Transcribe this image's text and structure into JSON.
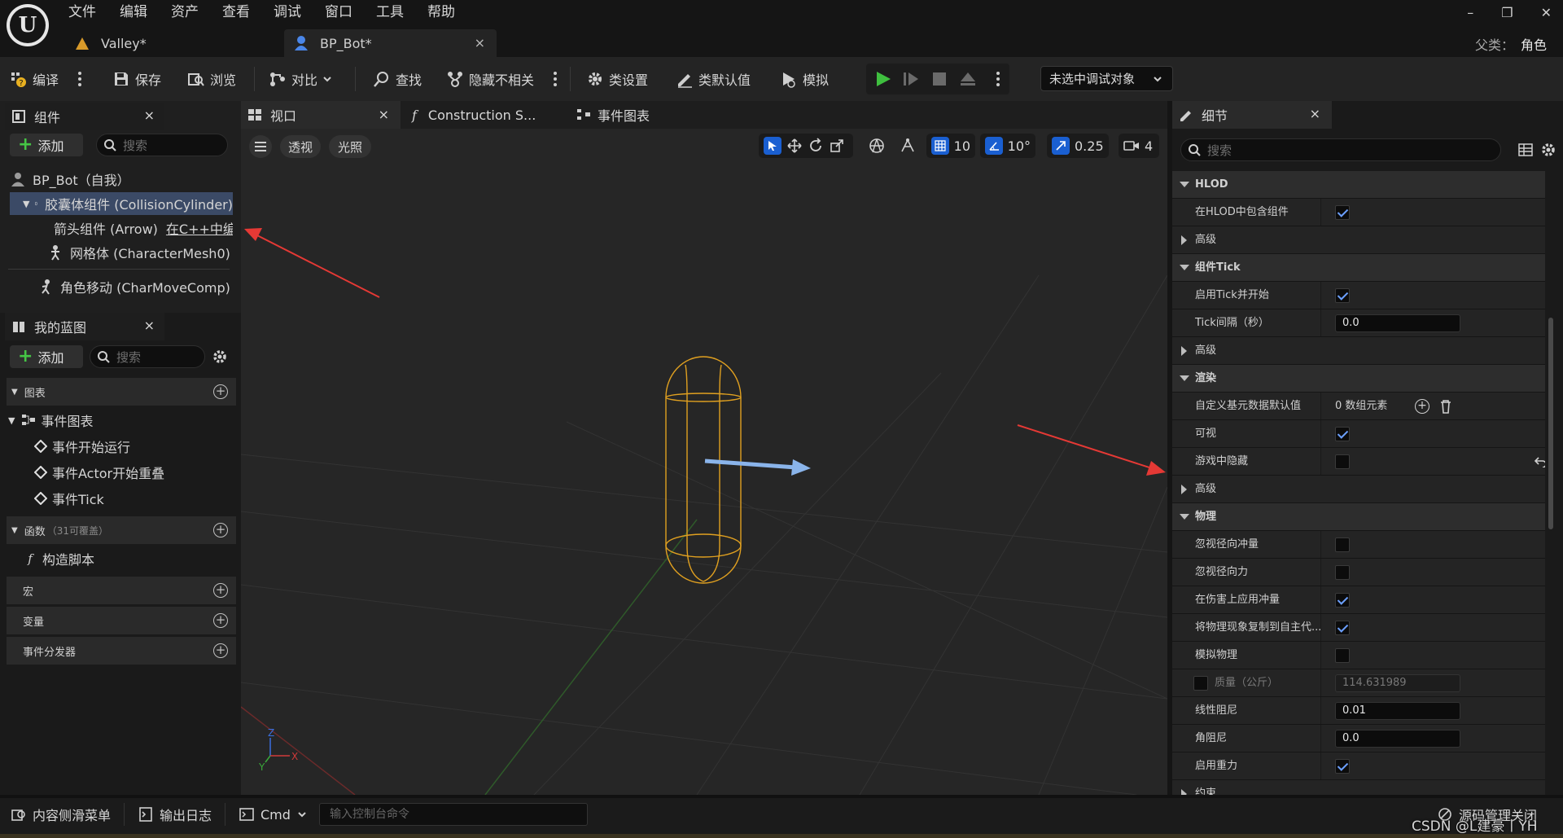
{
  "app": {
    "logo_text": "U"
  },
  "menu": [
    "文件",
    "编辑",
    "资产",
    "查看",
    "调试",
    "窗口",
    "工具",
    "帮助"
  ],
  "tabs": [
    {
      "label": "Valley*",
      "active": false
    },
    {
      "label": "BP_Bot*",
      "active": true,
      "close": "×"
    }
  ],
  "window_controls": {
    "minimize": "–",
    "restore": "❐",
    "close": "✕"
  },
  "parent_class": {
    "label": "父类：",
    "value": "角色"
  },
  "toolbar": {
    "compile": "编译",
    "save": "保存",
    "browse": "浏览",
    "diff": "对比",
    "find": "查找",
    "hide_unrelated": "隐藏不相关",
    "class_settings": "类设置",
    "class_defaults": "类默认值",
    "simulate": "模拟",
    "debug_object": "未选中调试对象",
    "play_color": "#3fbf3f"
  },
  "components_panel": {
    "title": "组件",
    "close": "×",
    "add": "添加",
    "search_placeholder": "搜索",
    "tree": [
      {
        "label": "BP_Bot（自我）"
      },
      {
        "label": "胶囊体组件 (CollisionCylinder)",
        "selected": true
      },
      {
        "label": "箭头组件 (Arrow)",
        "suffix": "在C++中编辑"
      },
      {
        "label": "网格体 (CharacterMesh0)"
      },
      {
        "label": "角色移动 (CharMoveComp)"
      }
    ]
  },
  "my_blueprint": {
    "title": "我的蓝图",
    "close": "×",
    "add": "添加",
    "search_placeholder": "搜索",
    "sections": {
      "graphs": "图表",
      "event_graph": "事件图表",
      "events": [
        "事件开始运行",
        "事件Actor开始重叠",
        "事件Tick"
      ],
      "functions": "函数",
      "functions_note": "（31可覆盖）",
      "construction_script": "构造脚本",
      "macros": "宏",
      "variables": "变量",
      "dispatchers": "事件分发器"
    }
  },
  "viewport": {
    "tabs": [
      "视口",
      "Construction S...",
      "事件图表"
    ],
    "close": "×",
    "perspective": "透视",
    "lighting": "光照",
    "grid_snap": "10",
    "rotation_snap": "10°",
    "scale_snap": "0.25",
    "camera_speed": "4",
    "capsule_color": "#e0a020",
    "arrow_color": "#8ab4ea",
    "axis": {
      "x": "X",
      "y": "Y",
      "z": "Z"
    }
  },
  "details": {
    "title": "细节",
    "close": "×",
    "search_placeholder": "搜索",
    "rows": [
      {
        "type": "category",
        "label": "HLOD"
      },
      {
        "type": "prop",
        "label": "在HLOD中包含组件",
        "check": true
      },
      {
        "type": "sub",
        "label": "高级"
      },
      {
        "type": "category",
        "label": "组件Tick"
      },
      {
        "type": "prop",
        "label": "启用Tick并开始",
        "check": true
      },
      {
        "type": "prop",
        "label": "Tick间隔（秒）",
        "value": "0.0"
      },
      {
        "type": "sub",
        "label": "高级"
      },
      {
        "type": "category",
        "label": "渲染"
      },
      {
        "type": "prop",
        "label": "自定义基元数据默认值",
        "text": "0 数组元素"
      },
      {
        "type": "prop",
        "label": "可视",
        "check": true
      },
      {
        "type": "prop",
        "label": "游戏中隐藏",
        "check": false,
        "reset": true
      },
      {
        "type": "sub",
        "label": "高级"
      },
      {
        "type": "category",
        "label": "物理"
      },
      {
        "type": "prop",
        "label": "忽视径向冲量",
        "check": false
      },
      {
        "type": "prop",
        "label": "忽视径向力",
        "check": false
      },
      {
        "type": "prop",
        "label": "在伤害上应用冲量",
        "check": true
      },
      {
        "type": "prop",
        "label": "将物理现象复制到自主代...",
        "check": true
      },
      {
        "type": "prop",
        "label": "模拟物理",
        "check": false
      },
      {
        "type": "prop",
        "label": "质量（公斤）",
        "value": "114.631989",
        "disabled": true
      },
      {
        "type": "prop",
        "label": "线性阻尼",
        "value": "0.01"
      },
      {
        "type": "prop",
        "label": "角阻尼",
        "value": "0.0"
      },
      {
        "type": "prop",
        "label": "启用重力",
        "check": true
      },
      {
        "type": "sub",
        "label": "约束"
      }
    ]
  },
  "statusbar": {
    "content_drawer": "内容侧滑菜单",
    "output_log": "输出日志",
    "cmd": "Cmd",
    "console_placeholder": "输入控制台命令",
    "source_control": "源码管理关闭",
    "watermark": "CSDN @L建豪丨YH"
  },
  "annotation_color": "#e53935"
}
